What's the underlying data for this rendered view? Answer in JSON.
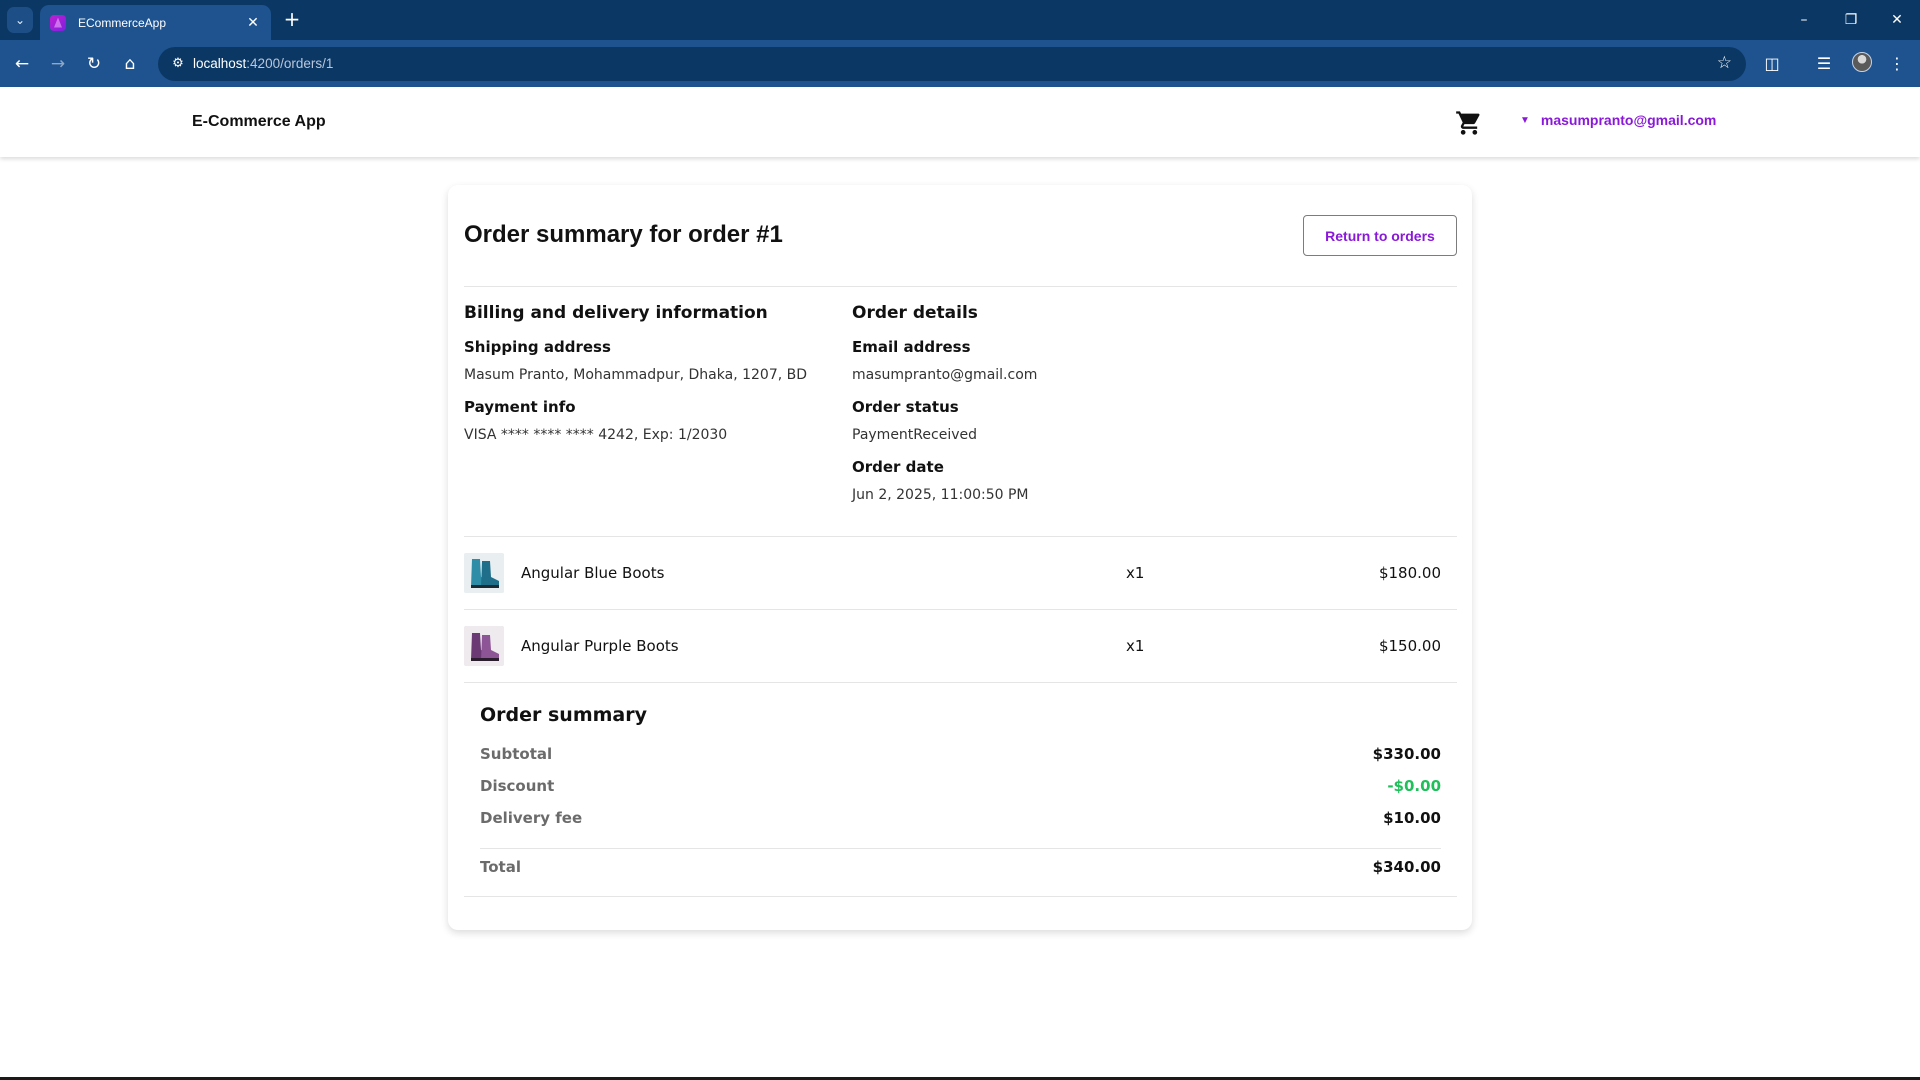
{
  "browser": {
    "tab_title": "ECommerceApp",
    "url_host": "localhost",
    "url_path": ":4200/orders/1"
  },
  "header": {
    "brand": "E-Commerce App",
    "user_email": "masumpranto@gmail.com"
  },
  "order": {
    "title": "Order summary for order #1",
    "return_label": "Return to orders",
    "billing_title": "Billing and delivery information",
    "shipping_label": "Shipping address",
    "shipping_value": "Masum Pranto, Mohammadpur, Dhaka, 1207, BD",
    "payment_label": "Payment info",
    "payment_value": "VISA **** **** **** 4242, Exp: 1/2030",
    "details_title": "Order details",
    "email_label": "Email address",
    "email_value": "masumpranto@gmail.com",
    "status_label": "Order status",
    "status_value": "PaymentReceived",
    "date_label": "Order date",
    "date_value": "Jun 2, 2025, 11:00:50 PM",
    "items": [
      {
        "name": "Angular Blue Boots",
        "qty": "x1",
        "price": "$180.00",
        "color": "#2f8da8"
      },
      {
        "name": "Angular Purple Boots",
        "qty": "x1",
        "price": "$150.00",
        "color": "#6b3a74"
      }
    ]
  },
  "summary": {
    "title": "Order summary",
    "subtotal_label": "Subtotal",
    "subtotal_value": "$330.00",
    "discount_label": "Discount",
    "discount_value": "-$0.00",
    "delivery_label": "Delivery fee",
    "delivery_value": "$10.00",
    "total_label": "Total",
    "total_value": "$340.00"
  },
  "colors": {
    "accent": "#8a18d8",
    "discount": "#1fbf5a",
    "chrome": "#1e5390"
  }
}
